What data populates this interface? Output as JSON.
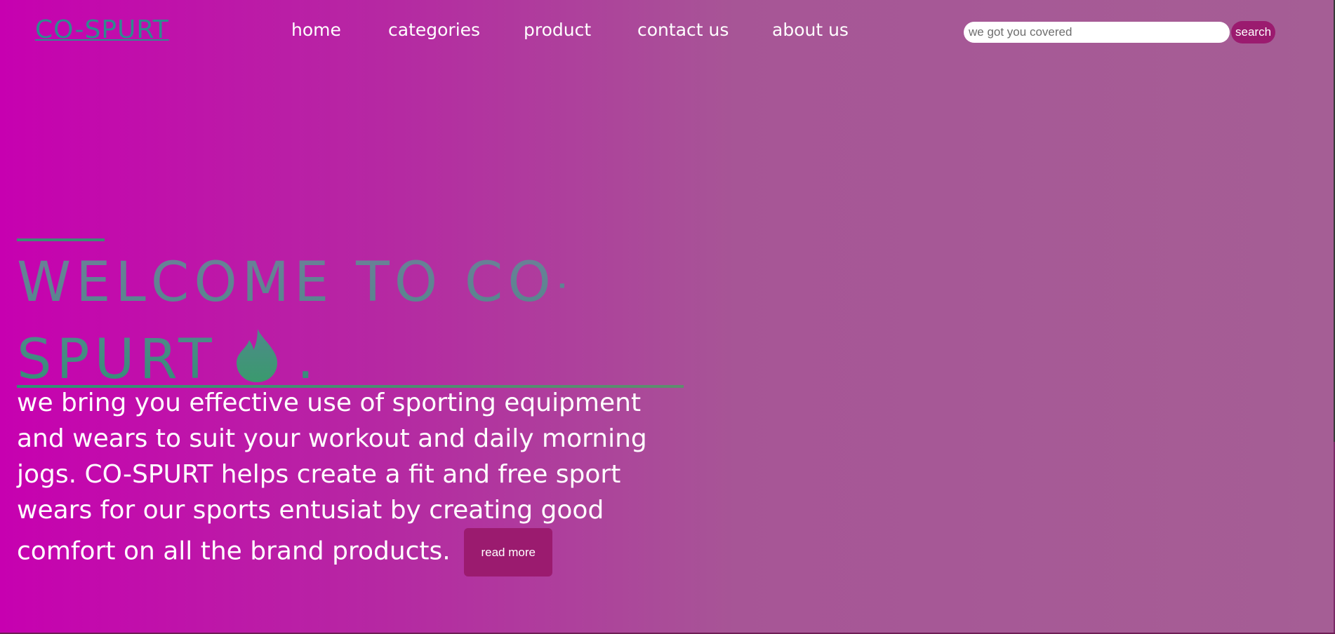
{
  "header": {
    "logo": "CO-SPURT",
    "nav": [
      {
        "label": "home"
      },
      {
        "label": "categories"
      },
      {
        "label": "product"
      },
      {
        "label": "contact us"
      },
      {
        "label": "about us"
      }
    ],
    "search": {
      "placeholder": "we got you covered",
      "value": "",
      "button_label": "search"
    }
  },
  "hero": {
    "title_line1": "WELCOME TO CO-",
    "title_line2": "SPURT",
    "title_suffix": ".",
    "description": "we bring you effective use of sporting equipment and wears to suit your workout and daily morning jogs. CO-SPURT helps create a fit and free sport wears for our sports entusiat by creating good comfort on all the brand products.",
    "read_more_label": "read more",
    "icon": "drop-icon"
  },
  "colors": {
    "background_start": "#c700b0",
    "background_end": "#a55e95",
    "accent_teal": "#2f8a8f",
    "button": "#9b1b6f"
  }
}
